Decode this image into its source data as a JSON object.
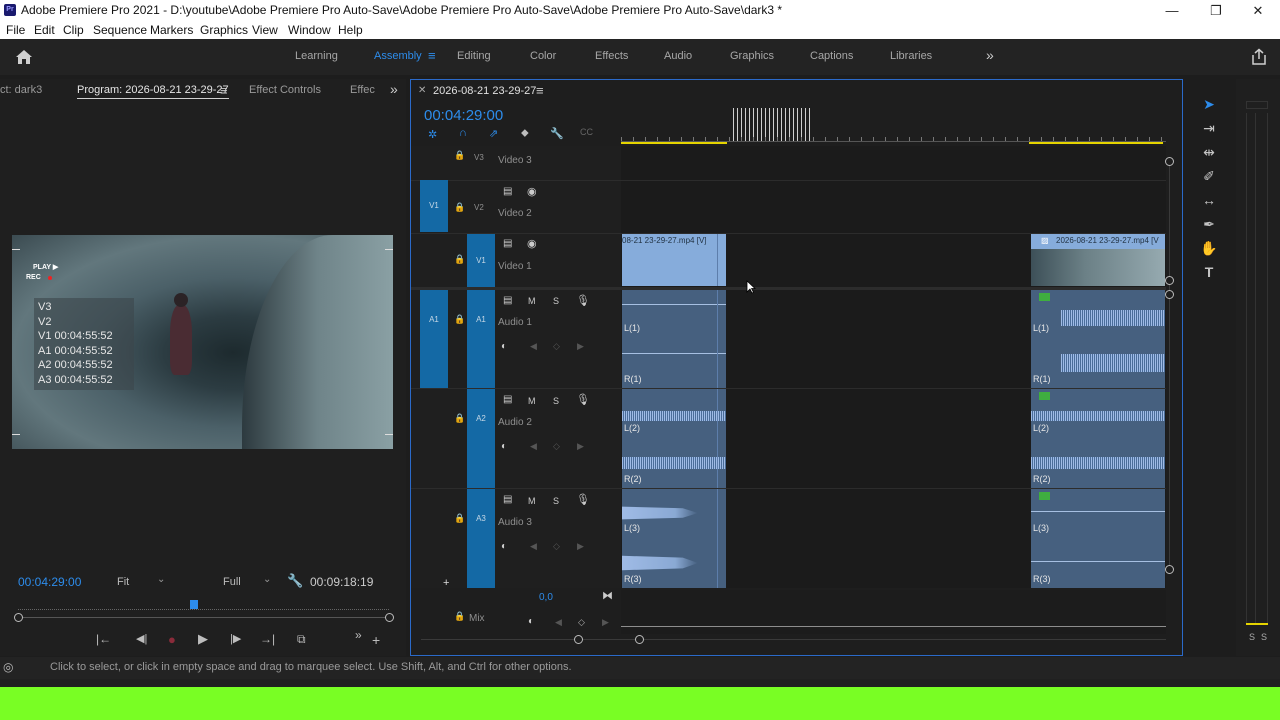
{
  "titlebar": {
    "title": "Adobe Premiere Pro 2021 - D:\\youtube\\Adobe Premiere Pro Auto-Save\\Adobe Premiere Pro Auto-Save\\Adobe Premiere Pro Auto-Save\\dark3 *",
    "app_icon": "Pr"
  },
  "menu": [
    "File",
    "Edit",
    "Clip",
    "Sequence",
    "Markers",
    "Graphics",
    "View",
    "Window",
    "Help"
  ],
  "workspaces": {
    "learning": "Learning",
    "assembly": "Assembly",
    "editing": "Editing",
    "color": "Color",
    "effects": "Effects",
    "audio": "Audio",
    "graphics": "Graphics",
    "captions": "Captions",
    "libraries": "Libraries"
  },
  "left_tabs": {
    "source": "ct: dark3",
    "program": "Program: 2026-08-21 23-29-27",
    "effect_controls": "Effect Controls",
    "effects": "Effec"
  },
  "program": {
    "osd_play": "PLAY ▶",
    "osd_rec": "REC",
    "tc_overlay": [
      "V3",
      "V2",
      "V1 00:04:55:52",
      "A1 00:04:55:52",
      "A2 00:04:55:52",
      "A3 00:04:55:52"
    ],
    "playhead_tc": "00:04:29:00",
    "fit": "Fit",
    "quality": "Full",
    "duration": "00:09:18:19"
  },
  "timeline": {
    "tab": "2026-08-21 23-29-27",
    "timecode": "00:04:29:00",
    "tracks": {
      "v3": "Video 3",
      "v2": "Video 2",
      "v1": "Video 1",
      "a1": "Audio 1",
      "a2": "Audio 2",
      "a3": "Audio 3",
      "mix": "Mix"
    },
    "ids": {
      "v3": "V3",
      "v2": "V2",
      "v1": "V1",
      "a1": "A1",
      "a2": "A2",
      "a3": "A3"
    },
    "src_v1": "V1",
    "src_a1": "A1",
    "clip1_label": "08-21 23-29-27.mp4 [V]",
    "clip2_label": "2026-08-21 23-29-27.mp4 [V",
    "mix_value": "0,0",
    "ch": {
      "l1": "L(1)",
      "r1": "R(1)",
      "l2": "L(2)",
      "r2": "R(2)",
      "l3": "L(3)",
      "r3": "R(3)"
    },
    "m": "M",
    "s": "S"
  },
  "status": "Click to select, or click in empty space and drag to marquee select. Use Shift, Alt, and Ctrl for other options.",
  "meter": {
    "s1": "S",
    "s2": "S"
  },
  "colors": {
    "accent": "#2d8ceb",
    "timeline_border": "#2b6ac9",
    "video_clip": "#86acdb",
    "audio_clip": "#46607f",
    "target": "#1469a5",
    "green": "#79fe24"
  }
}
